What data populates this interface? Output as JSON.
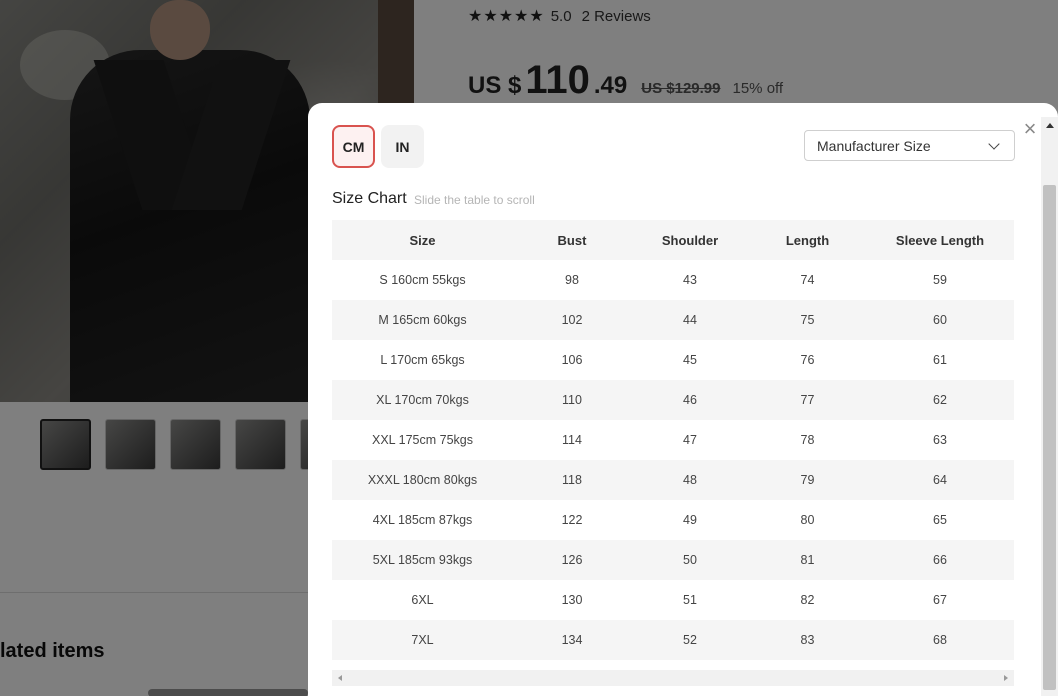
{
  "product": {
    "stars": "★★★★★",
    "rating": "5.0",
    "reviews": "2 Reviews",
    "price_prefix": "US $",
    "price_int": "110",
    "price_dec": ".49",
    "original_price": "US $129.99",
    "discount": "15% off"
  },
  "related": {
    "title": "lated items"
  },
  "modal": {
    "close_label": "×",
    "units": [
      {
        "label": "CM",
        "active": true
      },
      {
        "label": "IN",
        "active": false
      }
    ],
    "size_select": "Manufacturer Size",
    "chart_title": "Size Chart",
    "chart_hint": "Slide the table to scroll",
    "table": {
      "headers": [
        "Size",
        "Bust",
        "Shoulder",
        "Length",
        "Sleeve Length"
      ],
      "rows": [
        [
          "S 160cm 55kgs",
          "98",
          "43",
          "74",
          "59"
        ],
        [
          "M 165cm 60kgs",
          "102",
          "44",
          "75",
          "60"
        ],
        [
          "L 170cm 65kgs",
          "106",
          "45",
          "76",
          "61"
        ],
        [
          "XL 170cm 70kgs",
          "110",
          "46",
          "77",
          "62"
        ],
        [
          "XXL 175cm 75kgs",
          "114",
          "47",
          "78",
          "63"
        ],
        [
          "XXXL 180cm 80kgs",
          "118",
          "48",
          "79",
          "64"
        ],
        [
          "4XL 185cm 87kgs",
          "122",
          "49",
          "80",
          "65"
        ],
        [
          "5XL 185cm 93kgs",
          "126",
          "50",
          "81",
          "66"
        ],
        [
          "6XL",
          "130",
          "51",
          "82",
          "67"
        ],
        [
          "7XL",
          "134",
          "52",
          "83",
          "68"
        ]
      ]
    }
  },
  "colors": {
    "accent": "#d9534f",
    "overlay": "rgba(0,0,0,0.5)",
    "row_stripe": "#f5f5f5"
  }
}
